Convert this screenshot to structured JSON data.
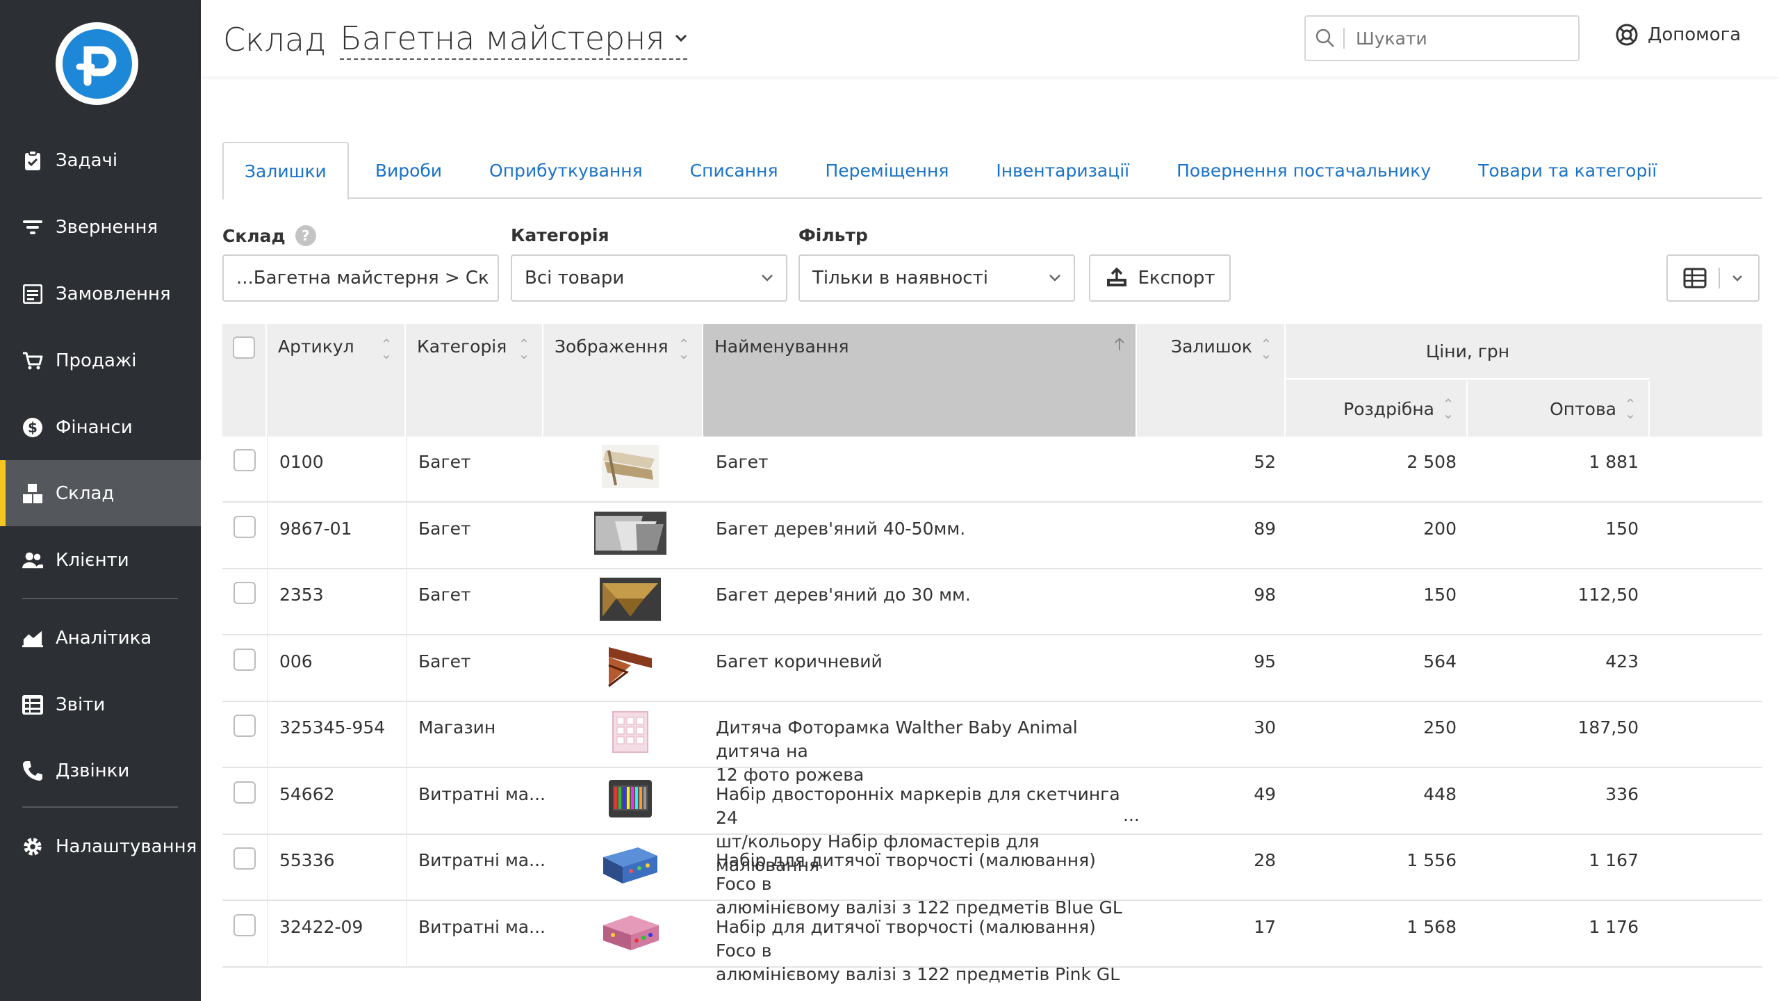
{
  "sidebar": {
    "items": [
      {
        "label": "Задачі",
        "icon": "clipboard-icon"
      },
      {
        "label": "Звернення",
        "icon": "filter-lines-icon"
      },
      {
        "label": "Замовлення",
        "icon": "order-list-icon"
      },
      {
        "label": "Продажі",
        "icon": "cart-icon"
      },
      {
        "label": "Фінанси",
        "icon": "dollar-icon"
      },
      {
        "label": "Склад",
        "icon": "boxes-icon"
      },
      {
        "label": "Клієнти",
        "icon": "users-icon"
      },
      {
        "label": "Аналітика",
        "icon": "area-chart-icon"
      },
      {
        "label": "Звіти",
        "icon": "report-icon"
      },
      {
        "label": "Дзвінки",
        "icon": "phone-icon"
      },
      {
        "label": "Налаштування",
        "icon": "gear-icon"
      }
    ],
    "active_index": 5
  },
  "header": {
    "title": "Склад",
    "warehouse": "Багетна майстерня",
    "search_placeholder": "Шукати",
    "help_label": "Допомога"
  },
  "tabs": [
    {
      "label": "Залишки",
      "active": true
    },
    {
      "label": "Вироби"
    },
    {
      "label": "Оприбуткування"
    },
    {
      "label": "Списання"
    },
    {
      "label": "Переміщення"
    },
    {
      "label": "Інвентаризації"
    },
    {
      "label": "Повернення постачальнику"
    },
    {
      "label": "Товари та категорії"
    }
  ],
  "filters": {
    "warehouse_label": "Склад",
    "warehouse_value": "...Багетна майстерня > Ск",
    "category_label": "Категорія",
    "category_value": "Всі товари",
    "filter_label": "Фільтр",
    "filter_value": "Тільки в наявності",
    "export_label": "Експорт"
  },
  "table": {
    "headers": {
      "sku": "Артикул",
      "category": "Категорія",
      "image": "Зображення",
      "name": "Найменування",
      "stock": "Залишок",
      "prices_group": "Ціни, грн",
      "retail": "Роздрібна",
      "wholesale": "Оптова"
    },
    "rows": [
      {
        "sku": "0100",
        "category": "Багет",
        "name": "Багет",
        "name2": "",
        "stock": "52",
        "retail": "2 508",
        "wholesale": "1 881",
        "thumb": "frame-light"
      },
      {
        "sku": "9867-01",
        "category": "Багет",
        "name": "Багет дерев'яний 40-50мм.",
        "name2": "",
        "stock": "89",
        "retail": "200",
        "wholesale": "150",
        "thumb": "frame-silver"
      },
      {
        "sku": "2353",
        "category": "Багет",
        "name": "Багет дерев'яний до 30 мм.",
        "name2": "",
        "stock": "98",
        "retail": "150",
        "wholesale": "112,50",
        "thumb": "frame-gold"
      },
      {
        "sku": "006",
        "category": "Багет",
        "name": "Багет коричневий",
        "name2": "",
        "stock": "95",
        "retail": "564",
        "wholesale": "423",
        "thumb": "frame-brown"
      },
      {
        "sku": "325345-954",
        "category": "Магазин",
        "name": "Дитяча Фоторамка Walther Baby Animal дитяча на",
        "name2": "12 фото рожева",
        "stock": "30",
        "retail": "250",
        "wholesale": "187,50",
        "thumb": "photo-pink"
      },
      {
        "sku": "54662",
        "category": "Витратні ма...",
        "name": "Набір двосторонніх маркерів для скетчинга 24",
        "name2": "шт/кольору Набір фломастерів для малювання",
        "ellipsis": "...",
        "stock": "49",
        "retail": "448",
        "wholesale": "336",
        "thumb": "markers"
      },
      {
        "sku": "55336",
        "category": "Витратні ма...",
        "name": "Набір для дитячої творчості (малювання) Foco в",
        "name2": "алюмінієвому валізі з 122 предметів Blue GL",
        "stock": "28",
        "retail": "1 556",
        "wholesale": "1 167",
        "thumb": "case-blue"
      },
      {
        "sku": "32422-09",
        "category": "Витратні ма...",
        "name": "Набір для дитячої творчості (малювання) Foco в",
        "name2": "алюмінієвому валізі з 122 предметів Pink GL",
        "stock": "17",
        "retail": "1 568",
        "wholesale": "1 176",
        "thumb": "case-pink"
      }
    ]
  },
  "colors": {
    "sidebar_bg": "#2c2f33",
    "sidebar_active": "#54585d",
    "accent_yellow": "#f5c623",
    "link_blue": "#1a73c9",
    "logo_blue": "#1e88d8"
  }
}
